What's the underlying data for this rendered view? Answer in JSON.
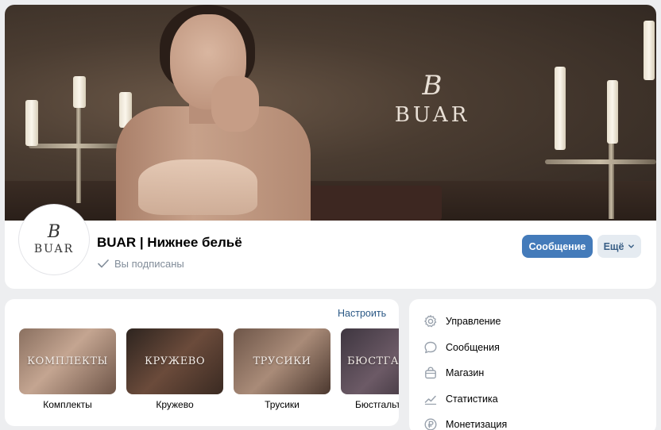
{
  "cover": {
    "brand_mono": "B",
    "brand_word": "BUAR"
  },
  "group": {
    "avatar_mono": "B",
    "avatar_word": "BUAR",
    "name": "BUAR | Нижнее бельё",
    "subscription_status": "Вы подписаны",
    "message_button": "Сообщение",
    "more_button": "Ещё"
  },
  "products": {
    "setup_link": "Настроить",
    "items": [
      {
        "label": "КОМПЛЕКТЫ",
        "caption": "Комплекты"
      },
      {
        "label": "КРУЖЕВО",
        "caption": "Кружево"
      },
      {
        "label": "ТРУСИКИ",
        "caption": "Трусики"
      },
      {
        "label": "БЮСТГАЛЬТЕРЫ",
        "caption": "Бюстгальтеры"
      }
    ]
  },
  "menu": {
    "items": [
      {
        "label": "Управление",
        "icon": "gear-icon"
      },
      {
        "label": "Сообщения",
        "icon": "chat-bubble-icon"
      },
      {
        "label": "Магазин",
        "icon": "shopping-bag-icon"
      },
      {
        "label": "Статистика",
        "icon": "trend-chart-icon"
      },
      {
        "label": "Монетизация",
        "icon": "ruble-coin-icon"
      }
    ]
  },
  "colors": {
    "accent": "#447bba",
    "link": "#2a5885",
    "page_bg": "#edeef0",
    "muted_text": "#818c99"
  }
}
